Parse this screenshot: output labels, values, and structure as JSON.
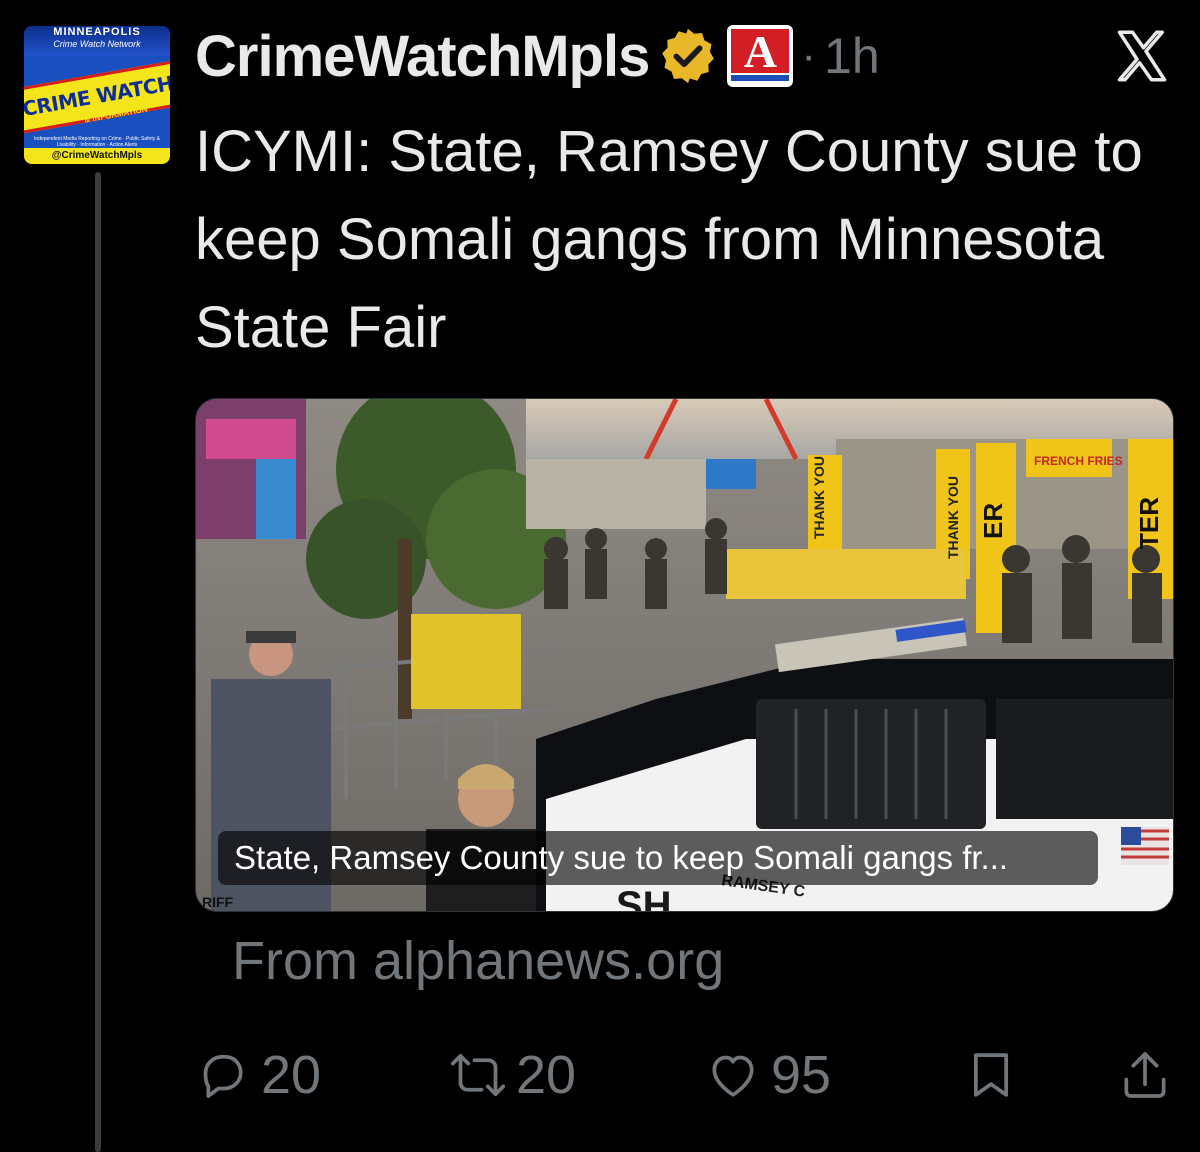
{
  "tweet": {
    "display_name": "CrimeWatchMpls",
    "time": "1h",
    "dot": "·",
    "text": "ICYMI: State, Ramsey County sue to keep Somali gangs from Minnesota State Fair",
    "avatar": {
      "city": "MINNEAPOLIS",
      "network": "Crime Watch Network",
      "banner": "CRIME WATCH",
      "sub": "& INFORMATION",
      "small_text": "Independent Media Reporting on Crime · Public Safety & Livability · Information · Action Alerts",
      "handle": "@CrimeWatchMpls"
    },
    "affiliate_badge": "A"
  },
  "card": {
    "caption": "State, Ramsey County sue to keep Somali gangs fr...",
    "source": "From alphanews.org",
    "scene_text": {
      "thank_you_1": "THANK YOU",
      "thank_you_2": "THANK YOU",
      "fries_sign": "FRENCH FRIES",
      "enter_1": "ER",
      "enter_2": "TER",
      "ramsey": "RAMSEY C",
      "sheriff": "RIFF",
      "sheriff_door": "SH"
    }
  },
  "actions": {
    "replies": "20",
    "reposts": "20",
    "likes": "95"
  },
  "colors": {
    "background": "#000000",
    "text_primary": "#e7e9ea",
    "text_secondary": "#71767b",
    "verified_gold": "#e8b829",
    "thread_line": "#3a3d40"
  },
  "icons": [
    "verified-gold-badge-icon",
    "affiliate-badge-icon",
    "x-logo-icon",
    "reply-icon",
    "repost-icon",
    "like-icon",
    "bookmark-icon",
    "share-icon"
  ]
}
